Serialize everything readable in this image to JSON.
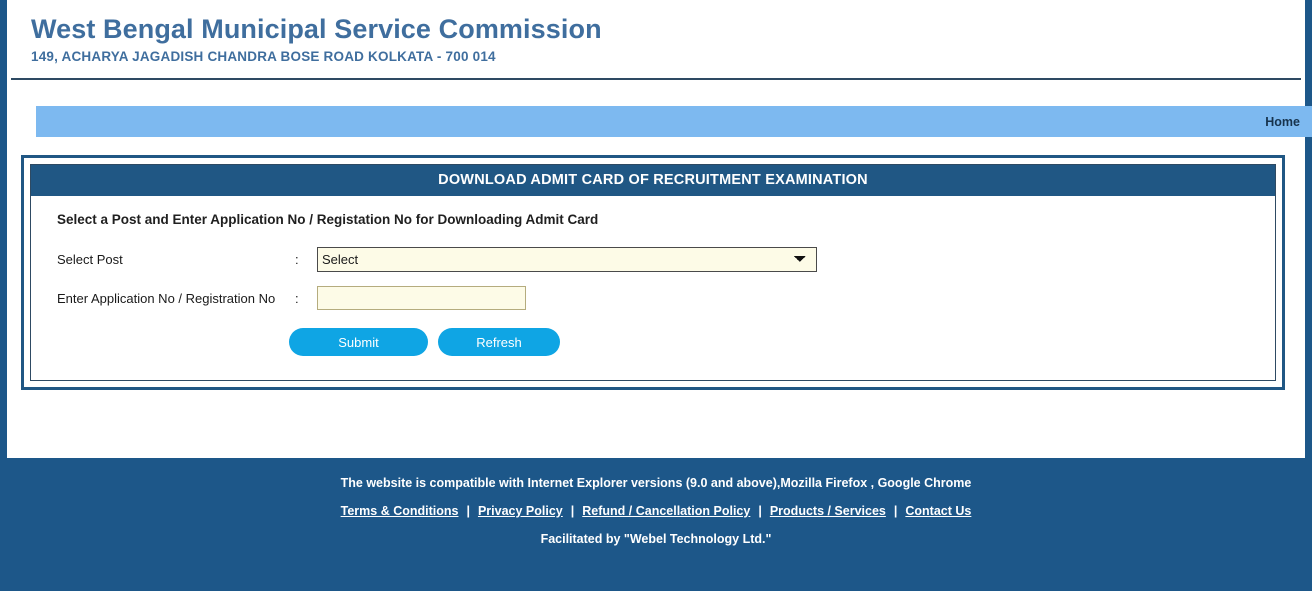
{
  "header": {
    "title": "West Bengal Municipal Service Commission",
    "address": "149, ACHARYA JAGADISH CHANDRA BOSE ROAD KOLKATA - 700 014"
  },
  "nav": {
    "home_label": "Home"
  },
  "panel": {
    "title": "DOWNLOAD ADMIT CARD OF RECRUITMENT EXAMINATION",
    "instruction": "Select a Post and Enter Application No / Registation No for Downloading Admit Card",
    "fields": {
      "post_label": "Select Post",
      "post_colon": ":",
      "post_value": "Select",
      "appno_label": "Enter Application No / Registration No",
      "appno_colon": ":",
      "appno_value": "",
      "appno_placeholder": ""
    },
    "buttons": {
      "submit_label": "Submit",
      "refresh_label": "Refresh"
    }
  },
  "footer": {
    "compatibility": "The website is compatible with Internet Explorer versions (9.0 and above),Mozilla Firefox , Google Chrome",
    "links": [
      {
        "label": "Terms & Conditions"
      },
      {
        "label": "Privacy Policy"
      },
      {
        "label": "Refund / Cancellation Policy"
      },
      {
        "label": "Products / Services"
      },
      {
        "label": "Contact Us"
      }
    ],
    "separator": "|",
    "facilitated": "Facilitated by \"Webel Technology Ltd.\""
  },
  "colors": {
    "brand_dark_blue": "#1d5789",
    "panel_header_blue": "#205784",
    "navbar_light_blue": "#7db9f0",
    "title_blue": "#3f6e9e",
    "button_cyan": "#0fa5e4",
    "input_cream": "#fdfbe7"
  }
}
